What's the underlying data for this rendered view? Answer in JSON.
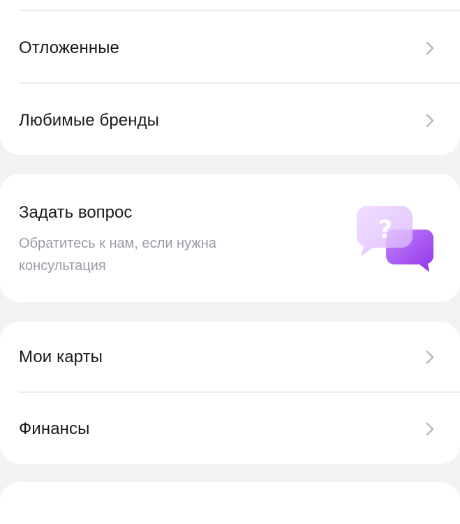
{
  "colors": {
    "background": "#f2f2f5",
    "card": "#ffffff",
    "primary_text": "#1a1a1d",
    "secondary_text": "#9a9aa8",
    "chevron": "#b8b8c4",
    "divider": "#ececf0",
    "accent_purple": "#a855f7"
  },
  "menu_top": {
    "items": [
      {
        "label": "Отложенные",
        "icon": "chevron-right-icon"
      },
      {
        "label": "Любимые бренды",
        "icon": "chevron-right-icon"
      }
    ]
  },
  "ask_question": {
    "title": "Задать вопрос",
    "subtitle": "Обратитесь к нам, если нужна консультация",
    "icon": "question-chat-bubbles-icon"
  },
  "menu_finance": {
    "items": [
      {
        "label": "Мои карты",
        "icon": "chevron-right-icon"
      },
      {
        "label": "Финансы",
        "icon": "chevron-right-icon"
      }
    ]
  }
}
